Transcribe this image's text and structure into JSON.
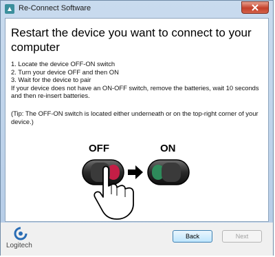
{
  "window": {
    "title": "Re-Connect Software",
    "icon": "logitech-app-icon",
    "close_icon": "close-icon"
  },
  "main": {
    "heading": "Restart the device you want to connect to your computer",
    "steps": [
      "1. Locate the device OFF-ON switch",
      "2. Turn your device OFF and then ON",
      "3. Wait for the device to pair",
      "If your device does not have an ON-OFF switch, remove the batteries, wait 10 seconds and then re-insert batteries."
    ],
    "tip": "(Tip: The OFF-ON switch is located either underneath or on the top-right corner of your device.)",
    "illustration": {
      "off_label": "OFF",
      "on_label": "ON",
      "off_color": "#c41e46",
      "on_color": "#2e8a5a"
    }
  },
  "footer": {
    "logo_text": "Logitech",
    "back_label": "Back",
    "next_label": "Next"
  }
}
